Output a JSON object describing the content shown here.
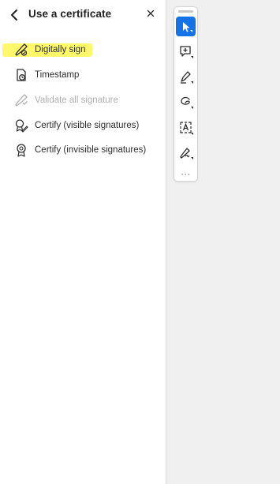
{
  "panel": {
    "title": "Use a certificate",
    "items": [
      {
        "label": "Digitally sign",
        "icon": "digital-sign-icon",
        "enabled": true,
        "highlighted": true
      },
      {
        "label": "Timestamp",
        "icon": "timestamp-icon",
        "enabled": true
      },
      {
        "label": "Validate all signature",
        "icon": "validate-signature-icon",
        "enabled": false
      },
      {
        "label": "Certify (visible signatures)",
        "icon": "certify-visible-icon",
        "enabled": true
      },
      {
        "label": "Certify (invisible signatures)",
        "icon": "certify-invisible-icon",
        "enabled": true
      }
    ]
  },
  "toolbar": {
    "tools": [
      {
        "name": "select-tool",
        "icon": "arrow-pointer-icon",
        "active": true
      },
      {
        "name": "add-comment-tool",
        "icon": "comment-plus-icon"
      },
      {
        "name": "highlight-tool",
        "icon": "pen-highlight-icon"
      },
      {
        "name": "draw-tool",
        "icon": "freehand-draw-icon"
      },
      {
        "name": "text-recognition-tool",
        "icon": "text-box-icon"
      },
      {
        "name": "sign-tool",
        "icon": "signature-pen-icon"
      }
    ],
    "more_label": "···"
  },
  "colors": {
    "accent": "#1473e6",
    "highlight": "#fff86b",
    "disabled_text": "#b1b1b1",
    "canvas_bg": "#f0f0f0"
  }
}
